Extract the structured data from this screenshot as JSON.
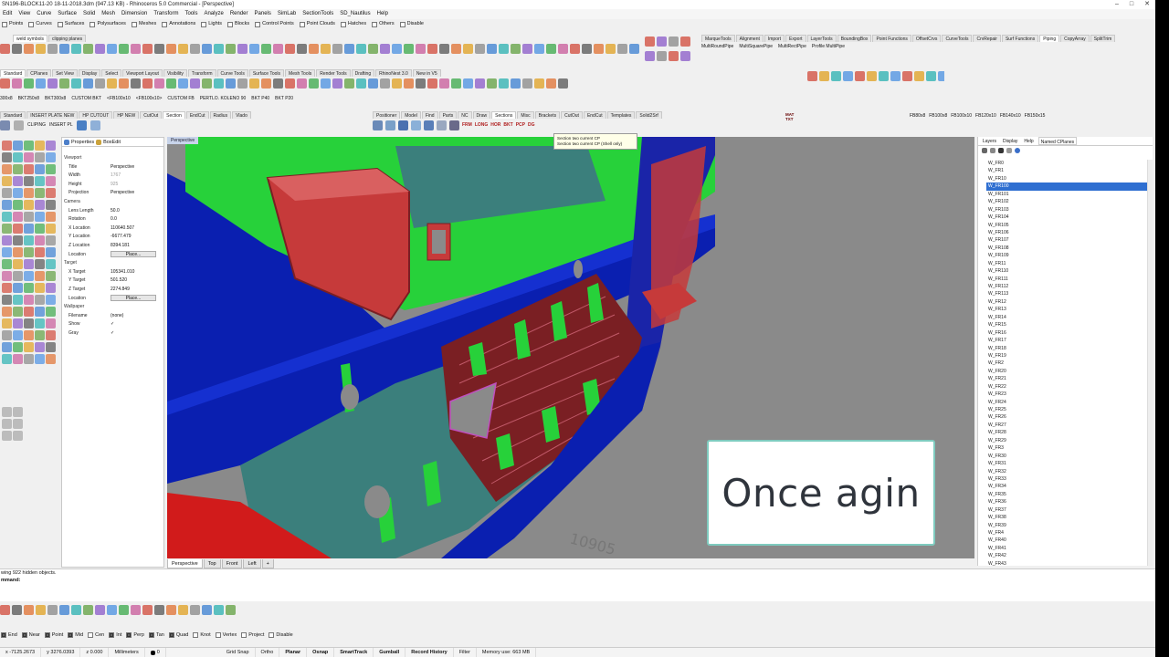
{
  "window": {
    "title": "SN196-BLOCK11-20 18-11-2018.3dm (947.13 KB) - Rhinoceros 5.0 Commercial - [Perspective]",
    "controls": [
      "–",
      "□",
      "✕"
    ]
  },
  "menu": [
    "Edit",
    "View",
    "Curve",
    "Surface",
    "Solid",
    "Mesh",
    "Dimension",
    "Transform",
    "Tools",
    "Analyze",
    "Render",
    "Panels",
    "SimLab",
    "SectionTools",
    "SD_Nautilus",
    "Help"
  ],
  "filter": [
    "Points",
    "Curves",
    "Surfaces",
    "Polysurfaces",
    "Meshes",
    "Annotations",
    "Lights",
    "Blocks",
    "Control Points",
    "Point Clouds",
    "Hatches",
    "Others",
    "Disable"
  ],
  "weld_tabs": [
    "weld symbols",
    "clipping planes"
  ],
  "right_tabs_top": [
    "MarqueTools",
    "Alignment",
    "Import",
    "Export",
    "LayerTools",
    "BoundingBox",
    "Point Functions",
    "OffsetCrvs",
    "CurveTools",
    "CrvRepair",
    "Surf Functions",
    "Piping",
    "CopyArray",
    "SplitTrim"
  ],
  "piping_items": [
    "MultiRoundPipe",
    "MultiSquarePipe",
    "MultiRectPipe",
    "Profile MultiPipe"
  ],
  "std_tabs": [
    "Standard",
    "CPlanes",
    "Set View",
    "Display",
    "Select",
    "Viewport Layout",
    "Visibility",
    "Transform",
    "Curve Tools",
    "Surface Tools",
    "Mesh Tools",
    "Render Tools",
    "Drafting",
    "RhinoNest 3.0",
    "New in V5"
  ],
  "bkt_row": [
    "300x8",
    "BKT250x8",
    "BKT300x8",
    "CUSTOM BKT",
    "<FB100x10",
    "<FB100x10>",
    "CUSTOM FB",
    "PERTLO. KOLENO 90",
    "BKT P40",
    "BKT P20"
  ],
  "insert_tabs": [
    "Standard",
    "INSERT PLATE NEW",
    "HP CUTOUT",
    "HP NEW",
    "CutOut",
    "Section",
    "EndCut",
    "Radius",
    "Vlado"
  ],
  "insert_labels": [
    "CLIPING",
    "INSERT PL"
  ],
  "positioner_tabs": [
    "Positioner",
    "Model",
    "Find",
    "Parts",
    "NC",
    "Draw",
    "Sections",
    "Misc",
    "Brackets",
    "CutOut",
    "EndCut",
    "Templates",
    "Solid2Srf"
  ],
  "section_labels": [
    "FRM",
    "LONG",
    "HOR",
    "BKT",
    "PCP",
    "DG"
  ],
  "tooltip": [
    "Section two current CP",
    "Section two current CP (Shell only)"
  ],
  "fb_labels": [
    "FB80x8",
    "FB100x8",
    "FB100x10",
    "FB120x10",
    "FB140x10",
    "FB150x15"
  ],
  "mattxt": "MAT TXT",
  "props": {
    "tabs": [
      "Properties",
      "BoxEdit"
    ],
    "sections": {
      "viewport": "Viewport",
      "camera": "Camera",
      "target": "Target",
      "wallpaper": "Wallpaper"
    },
    "viewport_rows": [
      {
        "k": "Title",
        "v": "Perspective",
        "dim": false
      },
      {
        "k": "Width",
        "v": "1767",
        "dim": true
      },
      {
        "k": "Height",
        "v": "925",
        "dim": true
      },
      {
        "k": "Projection",
        "v": "Perspective",
        "dim": false
      }
    ],
    "camera_rows": [
      {
        "k": "Lens Length",
        "v": "50.0"
      },
      {
        "k": "Rotation",
        "v": "0.0"
      },
      {
        "k": "X Location",
        "v": "110640.507"
      },
      {
        "k": "Y Location",
        "v": "-6677.479"
      },
      {
        "k": "Z Location",
        "v": "8394.181"
      }
    ],
    "target_rows": [
      {
        "k": "X Target",
        "v": "105341.010"
      },
      {
        "k": "Y Target",
        "v": "501.520"
      },
      {
        "k": "Z Target",
        "v": "2274.849"
      }
    ],
    "location_label": "Location",
    "place_label": "Place...",
    "wallpaper_rows": [
      {
        "k": "Filename",
        "v": "(none)"
      },
      {
        "k": "Show",
        "v": "✓"
      },
      {
        "k": "Gray",
        "v": "✓"
      }
    ]
  },
  "viewport": {
    "title": "Perspective",
    "tabs": [
      "Perspective",
      "Top",
      "Front",
      "Left",
      "+"
    ],
    "watermark": "10905",
    "colors": {
      "green": "#27d13a",
      "blue": "#0a1fb0",
      "red": "#c63a3a",
      "teal": "#3b7f7c",
      "maroon": "#7a1f23",
      "bg": "#8a8a8a"
    }
  },
  "overlay": {
    "text": "Once agin"
  },
  "rightpanel": {
    "tabs": [
      "Layers",
      "Display",
      "Help",
      "Named CPlanes"
    ],
    "selected": "W_FR100",
    "cplanes": [
      "W_FR0",
      "W_FR1",
      "W_FR10",
      "W_FR100",
      "W_FR101",
      "W_FR102",
      "W_FR103",
      "W_FR104",
      "W_FR105",
      "W_FR106",
      "W_FR107",
      "W_FR108",
      "W_FR109",
      "W_FR11",
      "W_FR110",
      "W_FR111",
      "W_FR112",
      "W_FR113",
      "W_FR12",
      "W_FR13",
      "W_FR14",
      "W_FR15",
      "W_FR16",
      "W_FR17",
      "W_FR18",
      "W_FR19",
      "W_FR2",
      "W_FR20",
      "W_FR21",
      "W_FR22",
      "W_FR23",
      "W_FR24",
      "W_FR25",
      "W_FR26",
      "W_FR27",
      "W_FR28",
      "W_FR29",
      "W_FR3",
      "W_FR30",
      "W_FR31",
      "W_FR32",
      "W_FR33",
      "W_FR34",
      "W_FR35",
      "W_FR36",
      "W_FR37",
      "W_FR38",
      "W_FR39",
      "W_FR4",
      "W_FR40",
      "W_FR41",
      "W_FR42",
      "W_FR43"
    ]
  },
  "command": {
    "history": "wing 922 hidden objects.",
    "prompt": "mmand:"
  },
  "osnap": [
    "End",
    "Near",
    "Point",
    "Mid",
    "Cen",
    "Int",
    "Perp",
    "Tan",
    "Quad",
    "Knot",
    "Vertex",
    "Project",
    "Disable"
  ],
  "osnap_checked": [
    true,
    true,
    true,
    true,
    false,
    true,
    true,
    true,
    true,
    false,
    false,
    false,
    false
  ],
  "status": {
    "x": "x -7125.2673",
    "y": "y 3276.0393",
    "z": "z 0.000",
    "units": "Millimeters",
    "layer": "0",
    "toggles": [
      "Grid Snap",
      "Ortho",
      "Planar",
      "Osnap",
      "SmartTrack",
      "Gumball",
      "Record History",
      "Filter"
    ],
    "bold_toggles": [
      "Planar",
      "Osnap",
      "SmartTrack",
      "Gumball",
      "Record History"
    ],
    "memory": "Memory use: 663 MB"
  }
}
